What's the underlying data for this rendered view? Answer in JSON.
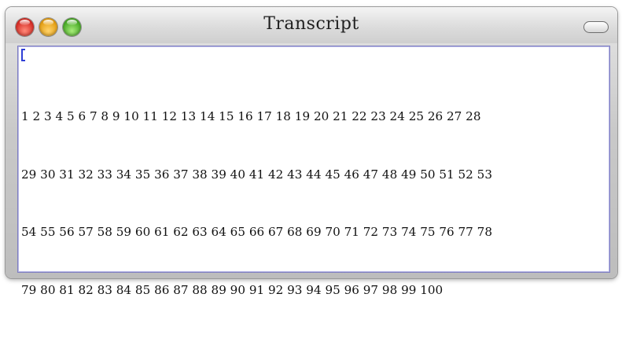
{
  "window": {
    "title": "Transcript"
  },
  "transcript": {
    "lines": [
      "1 2 3 4 5 6 7 8 9 10 11 12 13 14 15 16 17 18 19 20 21 22 23 24 25 26 27 28",
      "29 30 31 32 33 34 35 36 37 38 39 40 41 42 43 44 45 46 47 48 49 50 51 52 53",
      "54 55 56 57 58 59 60 61 62 63 64 65 66 67 68 69 70 71 72 73 74 75 76 77 78",
      "79 80 81 82 83 84 85 86 87 88 89 90 91 92 93 94 95 96 97 98 99 100"
    ]
  },
  "icons": {
    "close": "close-icon",
    "minimize": "minimize-icon",
    "zoom": "zoom-icon",
    "toolbar_toggle": "toolbar-toggle-icon"
  },
  "colors": {
    "close": "#d8322a",
    "minimize": "#e6a219",
    "zoom": "#4eae2c",
    "caret": "#2f3fd6",
    "content_border": "#7e7ec0"
  }
}
